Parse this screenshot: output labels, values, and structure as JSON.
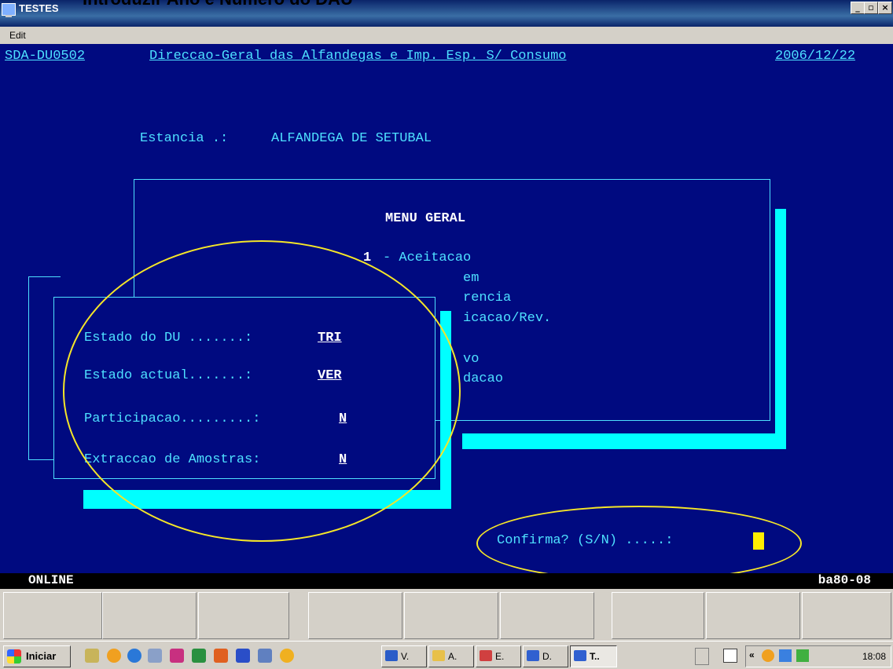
{
  "overlay_title": "Introduzir Ano e Número do DAU",
  "window": {
    "title": "TESTES",
    "menu": [
      "Edit"
    ],
    "controls": {
      "minimize": "_",
      "restore": "▫",
      "close": "×"
    }
  },
  "terminal": {
    "program_id": "SDA-DU0502",
    "header_title": "Direccao-Geral das Alfandegas e Imp. Esp. S/ Consumo",
    "date": "2006/12/22",
    "estancia_label": "Estancia .:",
    "estancia_value": "ALFANDEGA DE SETUBAL",
    "menu_title": "MENU GERAL",
    "menu_item_number": "1",
    "menu_item_text": "- Aceitacao",
    "menu_fragments": [
      "em",
      "rencia",
      "icacao/Rev.",
      "vo",
      "dacao"
    ],
    "fields": [
      {
        "label": "Estado do DU .......:",
        "value": "TRI"
      },
      {
        "label": "Estado actual.......:",
        "value": "VER"
      },
      {
        "label": "Participacao.........:",
        "value": "N"
      },
      {
        "label": "Extraccao de Amostras:",
        "value": "N"
      }
    ],
    "confirm_prompt": "Confirma? (S/N) .....:"
  },
  "status": {
    "left": "ONLINE",
    "right": "ba80-08"
  },
  "taskbar": {
    "start_label": "Iniciar",
    "tasks": [
      {
        "label": "V.",
        "icon_color": "#2a5cc8"
      },
      {
        "label": "A.",
        "icon_color": "#e8c04a"
      },
      {
        "label": "E.",
        "icon_color": "#d04040"
      },
      {
        "label": "D.",
        "icon_color": "#3060d0"
      },
      {
        "label": "T..",
        "icon_color": "#3060d0"
      }
    ],
    "clock": "18:08"
  },
  "colors": {
    "terminal_bg": "#000a80",
    "terminal_text": "#4ee0ff",
    "highlight": "#f5e628"
  }
}
